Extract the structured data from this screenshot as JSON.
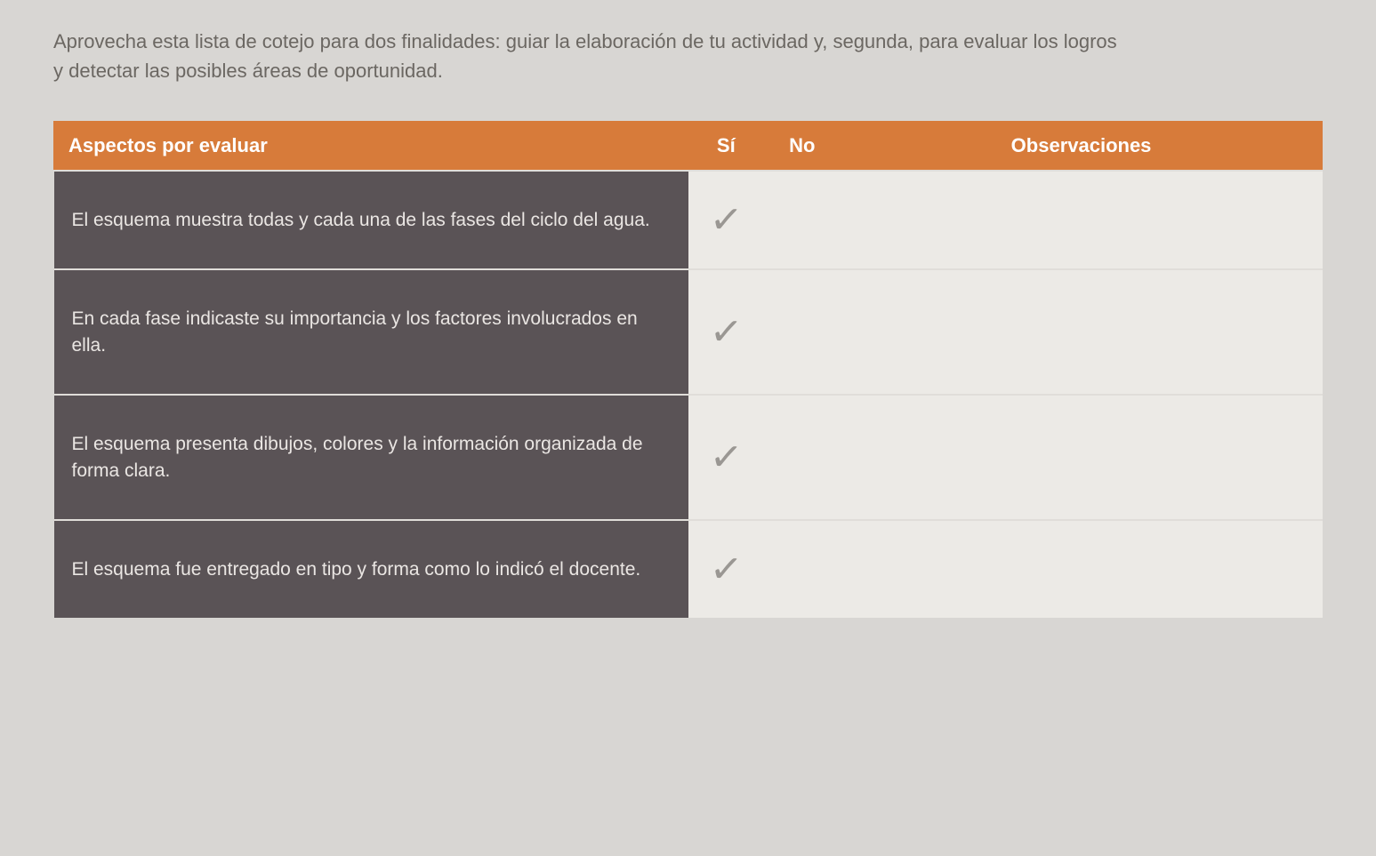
{
  "instruction": "Aprovecha esta lista de cotejo para dos finalidades: guiar la elaboración de tu actividad y, segunda, para evaluar los logros y detectar las posibles áreas de oportunidad.",
  "headers": {
    "aspect": "Aspectos por evaluar",
    "si": "Sí",
    "no": "No",
    "obs": "Observaciones"
  },
  "rows": [
    {
      "aspect": "El esquema muestra todas y cada una de las fases del ciclo del agua.",
      "si": "✓",
      "no": "",
      "obs": ""
    },
    {
      "aspect": "En cada fase indicaste su importancia y los factores involucrados en ella.",
      "si": "✓",
      "no": "",
      "obs": ""
    },
    {
      "aspect": "El esquema presenta dibujos, colores y la información organizada de forma clara.",
      "si": "✓",
      "no": "",
      "obs": ""
    },
    {
      "aspect": "El esquema fue entregado en tipo y forma como lo indicó el docente.",
      "si": "✓",
      "no": "",
      "obs": ""
    }
  ]
}
